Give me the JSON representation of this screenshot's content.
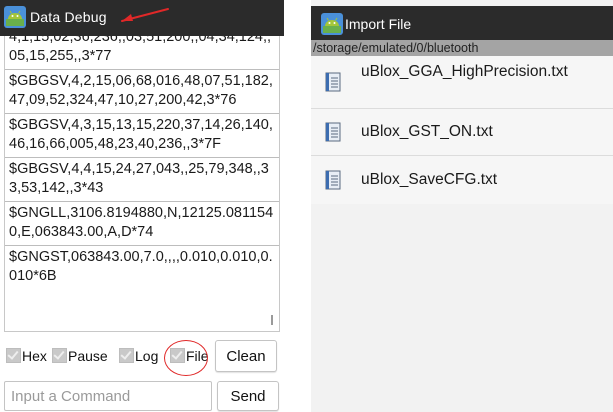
{
  "debug_screen": {
    "title": "Data Debug",
    "log_lines": [
      "4,1,15,02,36,236,,03,51,200,,04,34,124,,05,15,255,,3*77",
      "$GBGSV,4,2,15,06,68,016,48,07,51,182,47,09,52,324,47,10,27,200,42,3*76",
      "$GBGSV,4,3,15,13,15,220,37,14,26,140,46,16,66,005,48,23,40,236,,3*7F",
      "$GBGSV,4,4,15,24,27,043,,25,79,348,,33,53,142,,3*43",
      "$GNGLL,3106.8194880,N,12125.0811540,E,063843.00,A,D*74",
      "$GNGST,063843.00,7.0,,,,0.010,0.010,0.010*6B"
    ],
    "checkboxes": {
      "hex": "Hex",
      "pause": "Pause",
      "log": "Log",
      "file": "File"
    },
    "clean_button": "Clean",
    "command_placeholder": "Input a Command",
    "send_button": "Send"
  },
  "import_screen": {
    "title": "Import File",
    "path": "/storage/emulated/0/bluetooth",
    "files": [
      "uBlox_GGA_HighPrecision.txt",
      "uBlox_GST_ON.txt",
      "uBlox_SaveCFG.txt"
    ]
  },
  "colors": {
    "title_bar": "#2b2b2b",
    "annotation_red": "#e02828",
    "path_bar": "#a4a4a4",
    "file_list_bg": "#f6f6f6"
  },
  "icons": {
    "app_icon": "android-robot-icon",
    "file_icon": "text-file-icon",
    "annotation_arrow": "red-arrow-icon",
    "annotation_circle": "red-circle-highlight"
  }
}
